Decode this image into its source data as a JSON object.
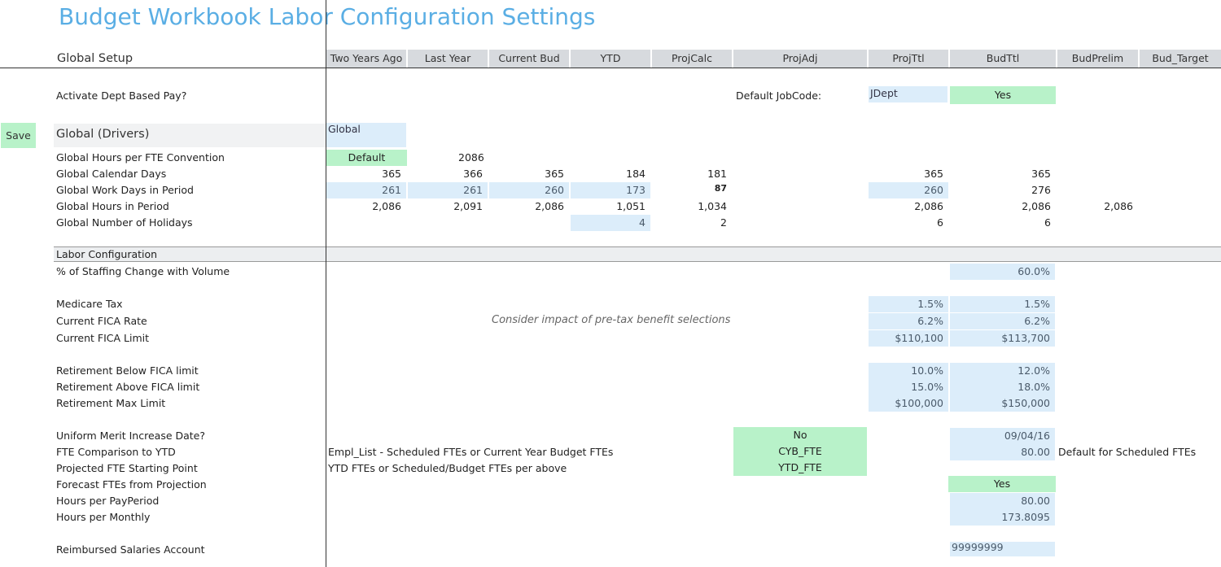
{
  "title": "Budget Workbook Labor Configuration Settings",
  "section_global_setup": "Global Setup",
  "columns": [
    "Two Years Ago",
    "Last Year",
    "Current Bud",
    "YTD",
    "ProjCalc",
    "ProjAdj",
    "ProjTtl",
    "BudTtl",
    "BudPrelim",
    "Bud_Target"
  ],
  "save_label": "Save",
  "dept_pay": {
    "label": "Activate Dept Based Pay?",
    "default_jobcode_label": "Default JobCode:",
    "jobcode_value": "JDept",
    "value": "Yes"
  },
  "drivers": {
    "title": "Global (Drivers)",
    "input_value": "Global"
  },
  "hours_fte": {
    "label": "Global Hours per FTE Convention",
    "dropdown": "Default",
    "value": "2086"
  },
  "calendar_days": {
    "label": "Global Calendar Days",
    "two_years_ago": "365",
    "last_year": "366",
    "current_bud": "365",
    "ytd": "184",
    "projcalc": "181",
    "projttl": "365",
    "budttl": "365"
  },
  "work_days": {
    "label": "Global Work Days in Period",
    "two_years_ago": "261",
    "last_year": "261",
    "current_bud": "260",
    "ytd": "173",
    "projcalc": "87",
    "projttl": "260",
    "budttl": "276"
  },
  "hours_period": {
    "label": "Global Hours in Period",
    "two_years_ago": "2,086",
    "last_year": "2,091",
    "current_bud": "2,086",
    "ytd": "1,051",
    "projcalc": "1,034",
    "projttl": "2,086",
    "budttl": "2,086",
    "budprelim": "2,086"
  },
  "holidays": {
    "label": "Global Number of Holidays",
    "ytd": "4",
    "projcalc": "2",
    "projttl": "6",
    "budttl": "6"
  },
  "labor": {
    "title": "Labor Configuration",
    "staffing_change": {
      "label": "% of Staffing Change with Volume",
      "budttl": "60.0%"
    },
    "medicare": {
      "label": "Medicare Tax",
      "projttl": "1.5%",
      "budttl": "1.5%"
    },
    "fica_rate": {
      "label": "Current FICA Rate",
      "projttl": "6.2%",
      "budttl": "6.2%"
    },
    "fica_limit": {
      "label": "Current FICA Limit",
      "projttl": "$110,100",
      "budttl": "$113,700"
    },
    "note": "Consider impact of pre-tax benefit selections",
    "ret_below": {
      "label": "Retirement Below FICA limit",
      "projttl": "10.0%",
      "budttl": "12.0%"
    },
    "ret_above": {
      "label": "Retirement Above FICA limit",
      "projttl": "15.0%",
      "budttl": "18.0%"
    },
    "ret_max": {
      "label": "Retirement Max Limit",
      "projttl": "$100,000",
      "budttl": "$150,000"
    },
    "merit": {
      "label": "Uniform Merit Increase Date?",
      "projadj": "No",
      "budttl": "09/04/16"
    },
    "fte_comp": {
      "label": "FTE Comparison to YTD",
      "description": "Empl_List - Scheduled FTEs or Current Year Budget FTEs",
      "projadj": "CYB_FTE",
      "budttl": "80.00",
      "note": "Default for Scheduled FTEs"
    },
    "proj_fte": {
      "label": "Projected FTE Starting Point",
      "description": "YTD FTEs or Scheduled/Budget FTEs per above",
      "projadj": "YTD_FTE"
    },
    "forecast_fte": {
      "label": "Forecast FTEs from Projection",
      "budttl": "Yes"
    },
    "hours_payperiod": {
      "label": "Hours per PayPeriod",
      "budttl": "80.00"
    },
    "hours_monthly": {
      "label": "Hours per Monthly",
      "budttl": "173.8095"
    },
    "reimbursed": {
      "label": "Reimbursed Salaries Account",
      "budttl": "99999999"
    }
  }
}
